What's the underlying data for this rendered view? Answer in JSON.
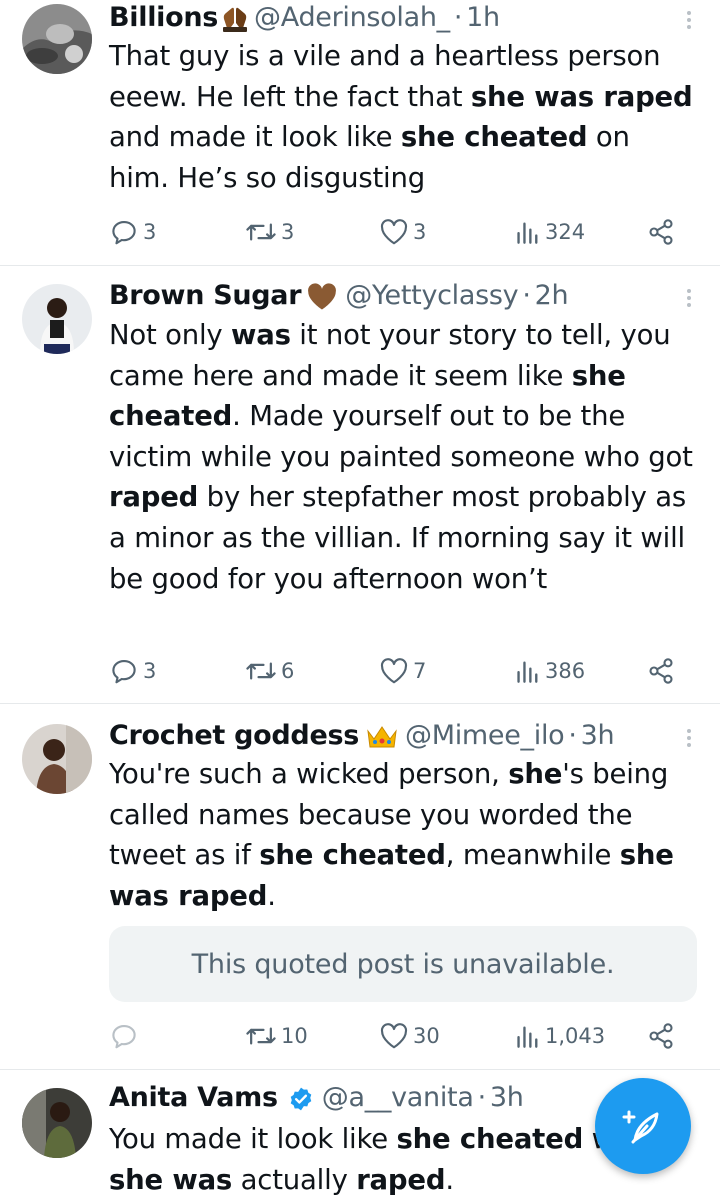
{
  "tweets": [
    {
      "name": "Billions",
      "emoji": "praying-hands",
      "handle": "@Aderinsolah_",
      "time": "1h",
      "body_html": "That guy is a vile and a heartless person eeew. He left the fact that <b>she was raped</b> and made it look like <b>she cheated</b> on him. He’s so disgusting",
      "replies": "3",
      "reposts": "3",
      "likes": "3",
      "views": "324"
    },
    {
      "name": "Brown Sugar",
      "emoji": "brown-heart",
      "handle": "@Yettyclassy",
      "time": "2h",
      "body_html": "Not only <b>was</b> it not your story to tell, you came here and made it seem like <b>she cheated</b>. Made yourself out to be the victim while you painted someone who got <b>raped</b> by her stepfather most probably as a minor as the villian. If morning say it will be good for you afternoon won’t",
      "replies": "3",
      "reposts": "6",
      "likes": "7",
      "views": "386"
    },
    {
      "name": "Crochet goddess",
      "emoji": "crown",
      "handle": "@Mimee_ilo",
      "time": "3h",
      "body_html": "You're such a wicked person, <b>she</b>'s being called names because you worded the tweet as if <b>she cheated</b>, meanwhile <b>she was raped</b>.",
      "quote_text": "This quoted post is unavailable.",
      "replies": "",
      "reposts": "10",
      "likes": "30",
      "views": "1,043"
    },
    {
      "name": "Anita Vams",
      "emoji": "verified-badge",
      "handle": "@a__vanita",
      "time": "3h",
      "body_html": "You made it look like <b>she cheated</b> w<br><b>she was</b> actually <b>raped</b>."
    }
  ],
  "separator": "·",
  "colors": {
    "text": "#0f1419",
    "secondary": "#536471",
    "divider": "#e6e9eb",
    "accent": "#1d9bf0",
    "verified": "#1d9bf0",
    "quote_bg": "#f0f3f4"
  },
  "icons": {
    "reply": "reply-icon",
    "repost": "repost-icon",
    "like": "heart-icon",
    "views": "views-icon",
    "share": "share-icon",
    "compose": "compose-feather-icon",
    "more": "more-vertical-icon"
  }
}
